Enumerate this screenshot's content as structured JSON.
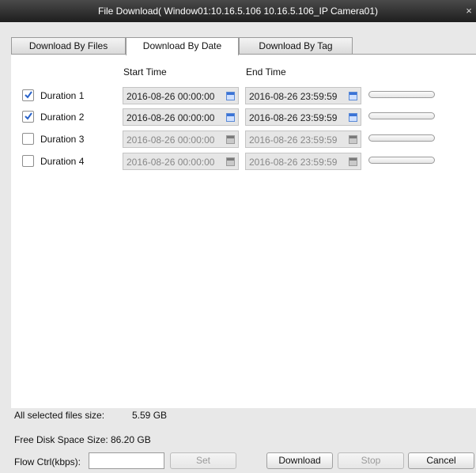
{
  "window": {
    "title": "File Download( Window01:10.16.5.106 10.16.5.106_IP Camera01)",
    "close_glyph": "×"
  },
  "tabs": [
    {
      "label": "Download By Files",
      "active": false
    },
    {
      "label": "Download By Date",
      "active": true
    },
    {
      "label": "Download By Tag",
      "active": false
    }
  ],
  "headers": {
    "start": "Start Time",
    "end": "End Time"
  },
  "durations": [
    {
      "label": "Duration 1",
      "checked": true,
      "start": "2016-08-26 00:00:00",
      "end": "2016-08-26 23:59:59",
      "progress": 0
    },
    {
      "label": "Duration 2",
      "checked": true,
      "start": "2016-08-26 00:00:00",
      "end": "2016-08-26 23:59:59",
      "progress": 0
    },
    {
      "label": "Duration 3",
      "checked": false,
      "start": "2016-08-26 00:00:00",
      "end": "2016-08-26 23:59:59",
      "progress": 0
    },
    {
      "label": "Duration 4",
      "checked": false,
      "start": "2016-08-26 00:00:00",
      "end": "2016-08-26 23:59:59",
      "progress": 0
    }
  ],
  "info": {
    "selected_size_label": "All selected files size:",
    "selected_size_value": "5.59 GB",
    "free_space_label": "Free Disk Space Size:",
    "free_space_value": "86.20 GB"
  },
  "flow": {
    "label": "Flow Ctrl(kbps):",
    "value": ""
  },
  "buttons": {
    "set": "Set",
    "download": "Download",
    "stop": "Stop",
    "cancel": "Cancel"
  },
  "icons": {
    "checkbox_check": "check-icon",
    "calendar": "calendar-icon",
    "close": "close-icon"
  },
  "colors": {
    "titlebar": "#2a2a2a",
    "check": "#2a63c9",
    "progress_fill": "#5b8ad6"
  }
}
